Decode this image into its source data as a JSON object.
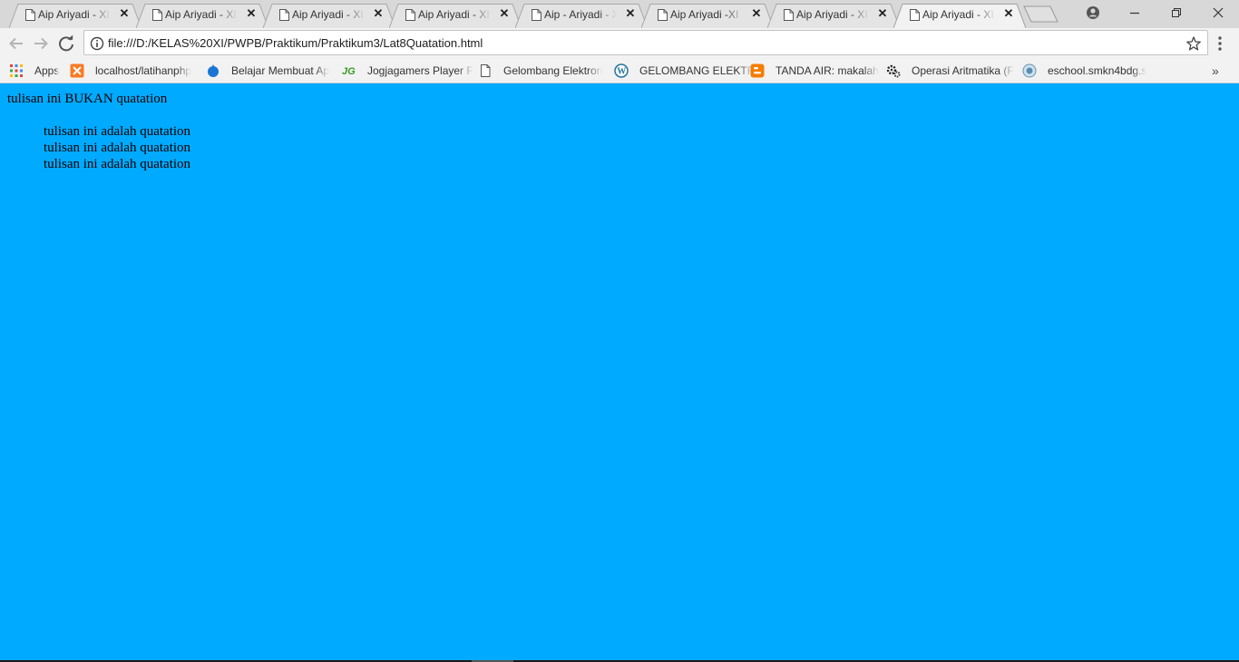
{
  "tabs": [
    {
      "title": "Aip Ariyadi - XI",
      "active": false
    },
    {
      "title": "Aip Ariyadi - XI",
      "active": false
    },
    {
      "title": "Aip Ariyadi - XI",
      "active": false
    },
    {
      "title": "Aip Ariyadi - XI",
      "active": false
    },
    {
      "title": "Aip - Ariyadi - XI",
      "active": false
    },
    {
      "title": "Aip Ariyadi -XI",
      "active": false
    },
    {
      "title": "Aip Ariyadi - XI",
      "active": false
    },
    {
      "title": "Aip Ariyadi - XI",
      "active": true
    }
  ],
  "tab_close_glyph": "✕",
  "toolbar": {
    "url": "file:///D:/KELAS%20XI/PWPB/Praktikum/Praktikum3/Lat8Quatation.html"
  },
  "bookmarks": [
    {
      "label": "Apps",
      "icon": "apps-grid-icon"
    },
    {
      "label": "localhost/latihanphp",
      "icon": "xampp-icon"
    },
    {
      "label": "Belajar Membuat Ap",
      "icon": "blue-drop-icon"
    },
    {
      "label": "Jogjagamers Player F",
      "icon": "jg-logo-icon"
    },
    {
      "label": "Gelombang Elektron",
      "icon": "page-icon"
    },
    {
      "label": "GELOMBANG ELEKTR",
      "icon": "wordpress-icon"
    },
    {
      "label": "TANDA AIR: makalah",
      "icon": "blogger-icon"
    },
    {
      "label": "Operasi Aritmatika (F",
      "icon": "gears-icon"
    },
    {
      "label": "eschool.smkn4bdg.s",
      "icon": "school-globe-icon"
    }
  ],
  "bookmarks_overflow": "»",
  "colors": {
    "page_background": "#00aaff",
    "tabstrip": "#d8d8d8",
    "toolbar": "#f2f2f2"
  },
  "page": {
    "plain_text": "tulisan ini BUKAN quatation",
    "quote_lines": [
      "tulisan ini adalah quatation",
      "tulisan ini adalah quatation",
      "tulisan ini adalah quatation"
    ]
  }
}
